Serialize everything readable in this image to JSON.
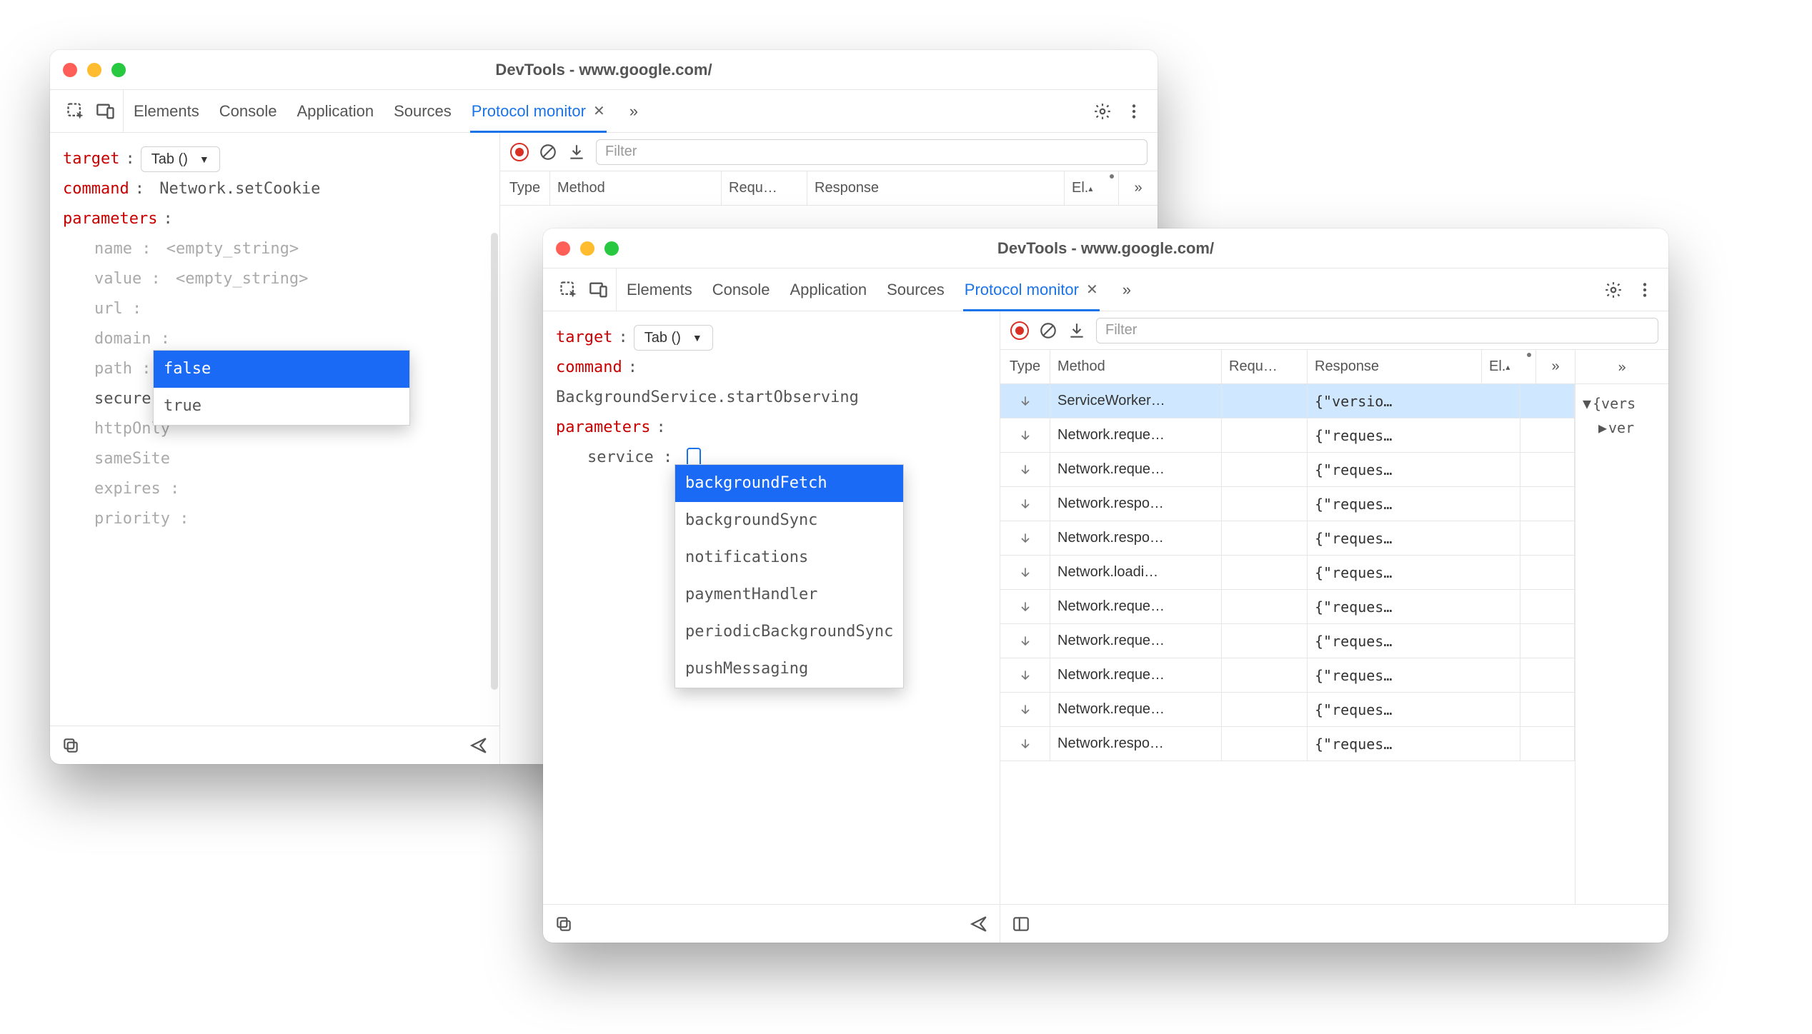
{
  "back": {
    "title": "DevTools - www.google.com/",
    "tabs": [
      "Elements",
      "Console",
      "Application",
      "Sources",
      "Protocol monitor"
    ],
    "active_tab": "Protocol monitor",
    "editor": {
      "target_label": "target",
      "target_value": "Tab ()",
      "command_label": "command",
      "command_value": "Network.setCookie",
      "parameters_label": "parameters",
      "params": [
        {
          "key": "name",
          "value": "<empty_string>"
        },
        {
          "key": "value",
          "value": "<empty_string>"
        },
        {
          "key": "url",
          "value": ""
        },
        {
          "key": "domain",
          "value": ""
        },
        {
          "key": "path",
          "value": ""
        },
        {
          "key": "secure",
          "value": "false",
          "editing": true
        },
        {
          "key": "httpOnly",
          "value": ""
        },
        {
          "key": "sameSite",
          "value": ""
        },
        {
          "key": "expires",
          "value": ""
        },
        {
          "key": "priority",
          "value": ""
        }
      ],
      "autocomplete": {
        "options": [
          "false",
          "true"
        ],
        "selected": "false"
      }
    },
    "monitor": {
      "filter_placeholder": "Filter",
      "columns": {
        "type": "Type",
        "method": "Method",
        "request": "Requ…",
        "response": "Response",
        "elapsed": "El.",
        "more": "»"
      }
    }
  },
  "front": {
    "title": "DevTools - www.google.com/",
    "tabs": [
      "Elements",
      "Console",
      "Application",
      "Sources",
      "Protocol monitor"
    ],
    "active_tab": "Protocol monitor",
    "editor": {
      "target_label": "target",
      "target_value": "Tab ()",
      "command_label": "command",
      "command_value": "BackgroundService.startObserving",
      "parameters_label": "parameters",
      "params": [
        {
          "key": "service",
          "value": "",
          "editing": true
        }
      ],
      "autocomplete": {
        "options": [
          "backgroundFetch",
          "backgroundSync",
          "notifications",
          "paymentHandler",
          "periodicBackgroundSync",
          "pushMessaging"
        ],
        "selected": "backgroundFetch"
      }
    },
    "monitor": {
      "filter_placeholder": "Filter",
      "columns": {
        "type": "Type",
        "method": "Method",
        "request": "Requ…",
        "response": "Response",
        "elapsed": "El.",
        "more": "»"
      },
      "rows": [
        {
          "method": "ServiceWorker…",
          "response": "{\"versio…",
          "selected": true
        },
        {
          "method": "Network.reque…",
          "response": "{\"reques…"
        },
        {
          "method": "Network.reque…",
          "response": "{\"reques…"
        },
        {
          "method": "Network.respo…",
          "response": "{\"reques…"
        },
        {
          "method": "Network.respo…",
          "response": "{\"reques…"
        },
        {
          "method": "Network.loadi…",
          "response": "{\"reques…"
        },
        {
          "method": "Network.reque…",
          "response": "{\"reques…"
        },
        {
          "method": "Network.reque…",
          "response": "{\"reques…"
        },
        {
          "method": "Network.reque…",
          "response": "{\"reques…"
        },
        {
          "method": "Network.reque…",
          "response": "{\"reques…"
        },
        {
          "method": "Network.respo…",
          "response": "{\"reques…"
        }
      ],
      "side_panel": {
        "root": "{vers",
        "child": "ver"
      }
    }
  }
}
